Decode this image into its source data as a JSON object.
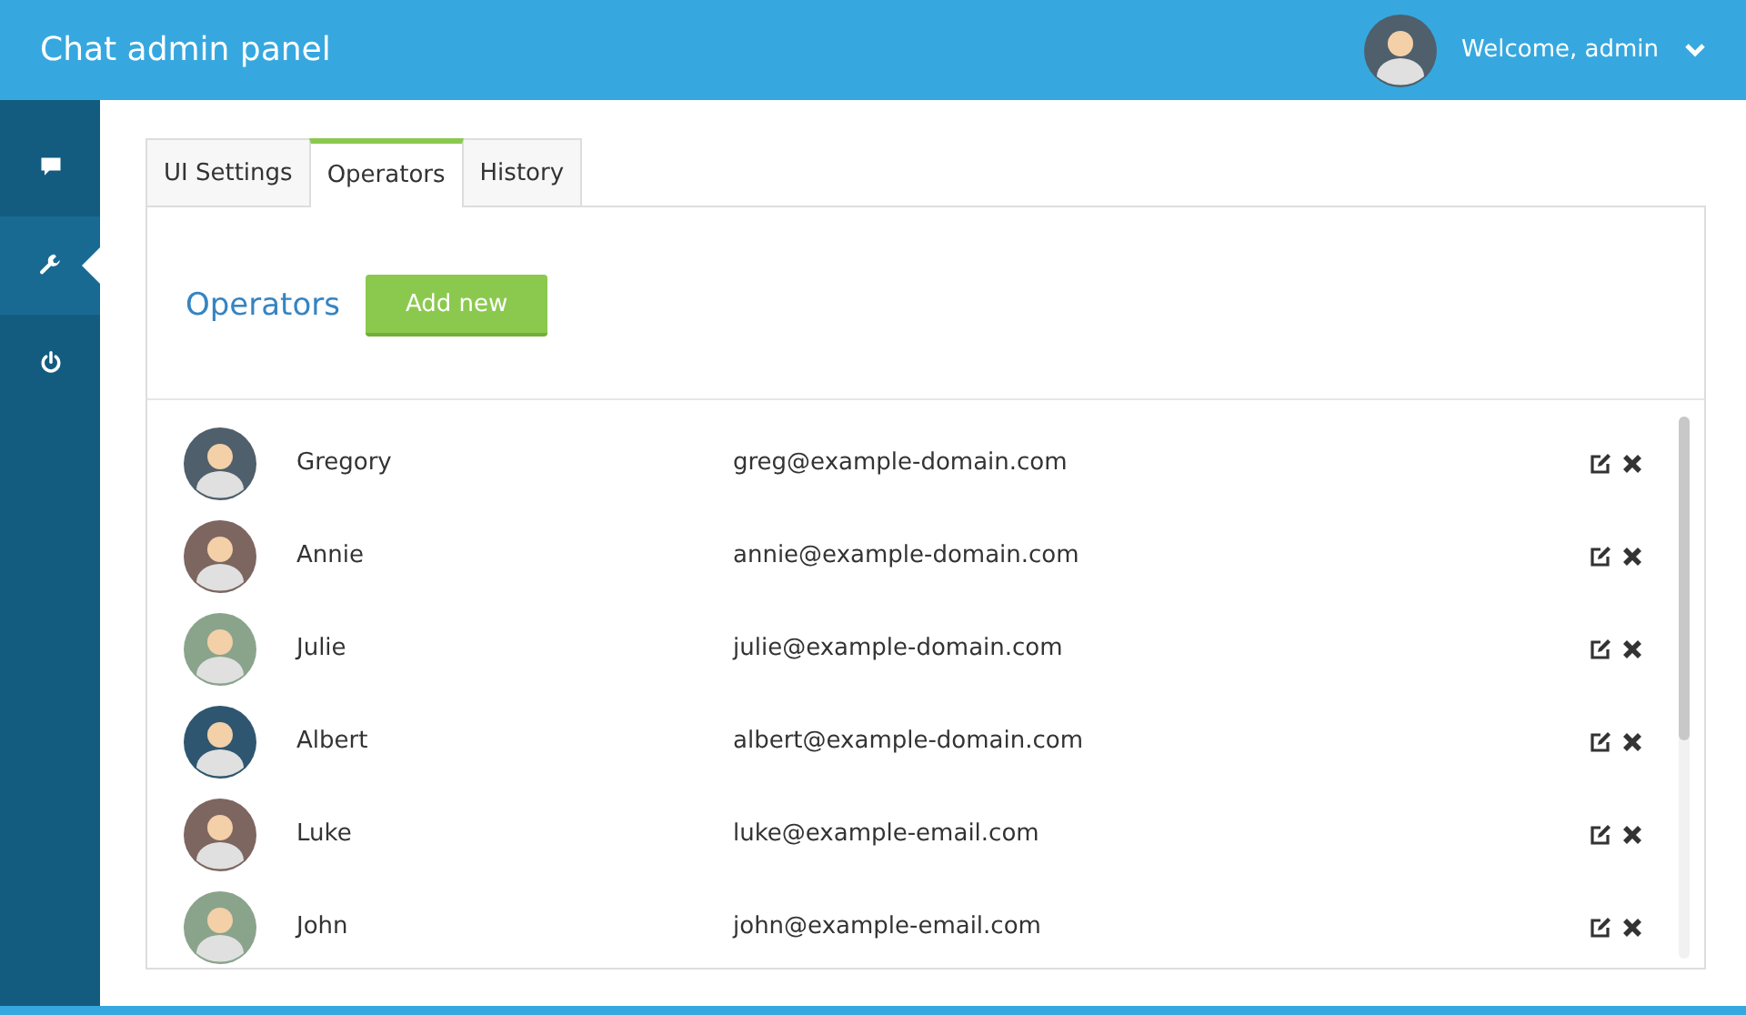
{
  "header": {
    "title": "Chat admin panel",
    "welcome": "Welcome, admin"
  },
  "sidebar": {
    "items": [
      {
        "kind": "chat",
        "selected": false
      },
      {
        "kind": "wrench",
        "selected": true
      },
      {
        "kind": "power",
        "selected": false
      }
    ]
  },
  "tabs": [
    {
      "label": "UI Settings",
      "selected": false
    },
    {
      "label": "Operators",
      "selected": true
    },
    {
      "label": "History",
      "selected": false
    }
  ],
  "section": {
    "title": "Operators",
    "add_button": "Add new"
  },
  "operators": [
    {
      "name": "Gregory",
      "email": "greg@example-domain.com",
      "color": "#4f5f6b"
    },
    {
      "name": "Annie",
      "email": "annie@example-domain.com",
      "color": "#7d6560"
    },
    {
      "name": "Julie",
      "email": "julie@example-domain.com",
      "color": "#8aa48c"
    },
    {
      "name": "Albert",
      "email": "albert@example-domain.com",
      "color": "#2f5670"
    },
    {
      "name": "Luke",
      "email": "luke@example-email.com",
      "color": "#7d6560"
    },
    {
      "name": "John",
      "email": "john@example-email.com",
      "color": "#8aa48c"
    }
  ]
}
